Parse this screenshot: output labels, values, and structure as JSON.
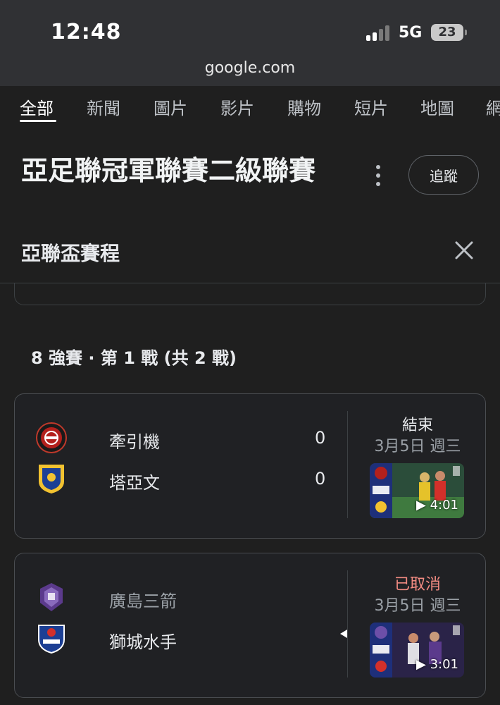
{
  "status_bar": {
    "time": "12:48",
    "network": "5G",
    "battery": "23"
  },
  "browser": {
    "url": "google.com"
  },
  "tabs": [
    {
      "label": "全部",
      "active": true
    },
    {
      "label": "新聞"
    },
    {
      "label": "圖片"
    },
    {
      "label": "影片"
    },
    {
      "label": "購物"
    },
    {
      "label": "短片"
    },
    {
      "label": "地圖"
    },
    {
      "label": "網"
    }
  ],
  "header": {
    "title": "亞足聯冠軍聯賽二級聯賽",
    "follow_label": "追蹤",
    "subtitle": "亞聯盃賽程"
  },
  "round_label": "8 強賽 · 第 1 戰 (共 2 戰)",
  "matches": [
    {
      "home": {
        "name": "牽引機",
        "score": "0"
      },
      "away": {
        "name": "塔亞文",
        "score": "0"
      },
      "status": "結束",
      "date": "3月5日 週三",
      "video_duration": "▶ 4:01",
      "status_color": "#e8eaed"
    },
    {
      "home": {
        "name": "廣島三箭"
      },
      "away": {
        "name": "獅城水手"
      },
      "status": "已取消",
      "date": "3月5日 週三",
      "video_duration": "▶ 3:01",
      "status_color": "#f28b82"
    }
  ],
  "icons": {
    "signal": "signal-icon",
    "more": "more-vert-icon",
    "close": "close-icon",
    "play": "play-icon"
  }
}
